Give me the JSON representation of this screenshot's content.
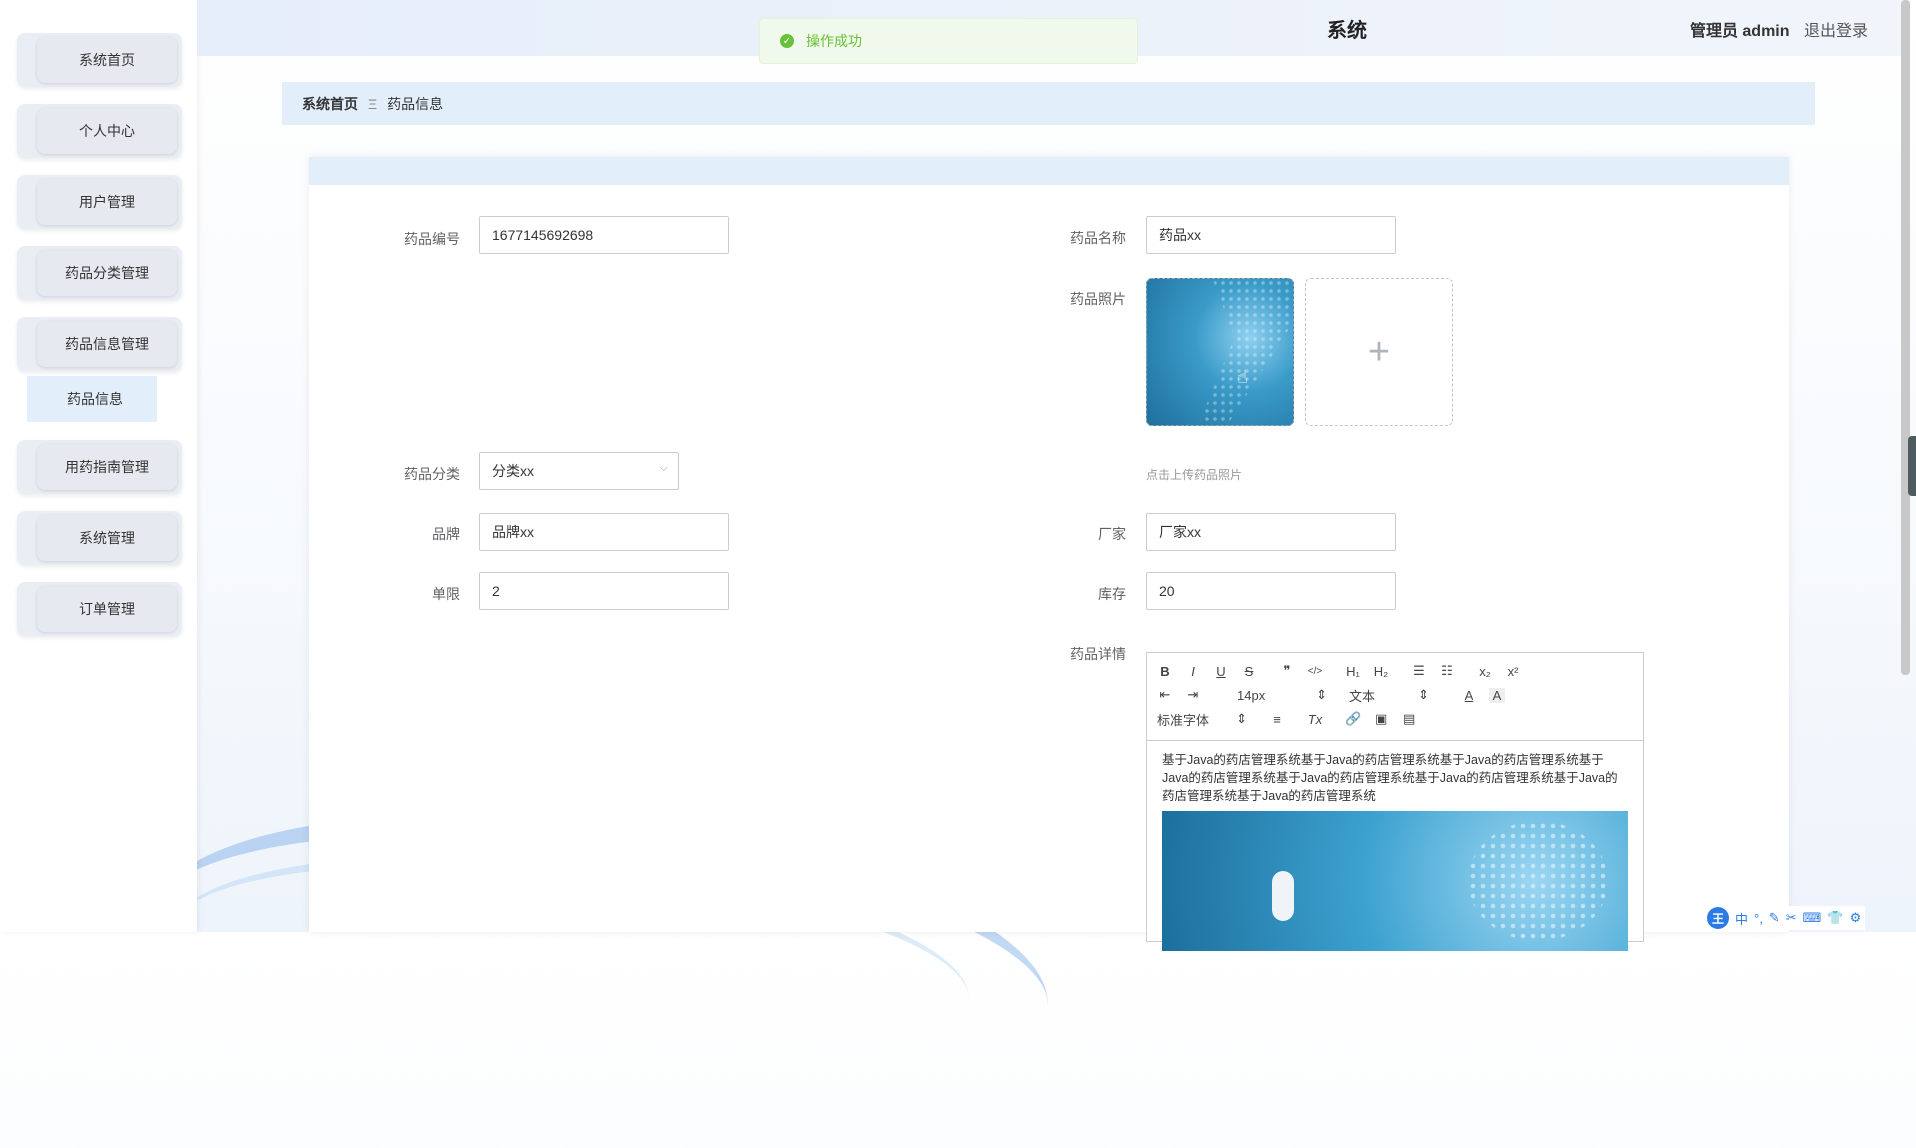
{
  "header": {
    "title": "系统",
    "role": "管理员 admin",
    "logout": "退出登录"
  },
  "toast": {
    "message": "操作成功"
  },
  "sidebar": {
    "items": [
      {
        "label": "系统首页"
      },
      {
        "label": "个人中心"
      },
      {
        "label": "用户管理"
      },
      {
        "label": "药品分类管理"
      },
      {
        "label": "药品信息管理"
      },
      {
        "label": "用药指南管理"
      },
      {
        "label": "系统管理"
      },
      {
        "label": "订单管理"
      }
    ],
    "active_sub": "药品信息"
  },
  "breadcrumb": {
    "home": "系统首页",
    "separator": "Ξ",
    "current": "药品信息"
  },
  "form": {
    "code": {
      "label": "药品编号",
      "value": "1677145692698"
    },
    "name": {
      "label": "药品名称",
      "value": "药品xx"
    },
    "photo": {
      "label": "药品照片",
      "hint": "点击上传药品照片",
      "add_icon": "+"
    },
    "category": {
      "label": "药品分类",
      "value": "分类xx"
    },
    "brand": {
      "label": "品牌",
      "value": "品牌xx"
    },
    "maker": {
      "label": "厂家",
      "value": "厂家xx"
    },
    "limit": {
      "label": "单限",
      "value": "2"
    },
    "stock": {
      "label": "库存",
      "value": "20"
    },
    "detail": {
      "label": "药品详情",
      "font_size": "14px",
      "text_type": "文本",
      "font_family": "标准字体",
      "content": "基于Java的药店管理系统基于Java的药店管理系统基于Java的药店管理系统基于Java的药店管理系统基于Java的药店管理系统基于Java的药店管理系统基于Java的药店管理系统基于Java的药店管理系统"
    }
  },
  "toolbar": {
    "bold": "B",
    "italic": "I",
    "underline": "U",
    "strike": "S",
    "quote": "❞",
    "code": "</>",
    "h1": "H₁",
    "h2": "H₂",
    "ordered": "☰",
    "bullet": "☷",
    "sub": "x₂",
    "sup": "x²",
    "outdent": "⇤",
    "indent": "⇥",
    "color": "A",
    "bg": "A",
    "align": "≡",
    "clean": "Tx",
    "link": "🔗",
    "image": "▣",
    "video": "▤"
  },
  "ime": {
    "logo": "王",
    "lang": "中",
    "items": [
      "°,",
      "✎",
      "✂",
      "⌨",
      "👕",
      "⚙"
    ]
  }
}
